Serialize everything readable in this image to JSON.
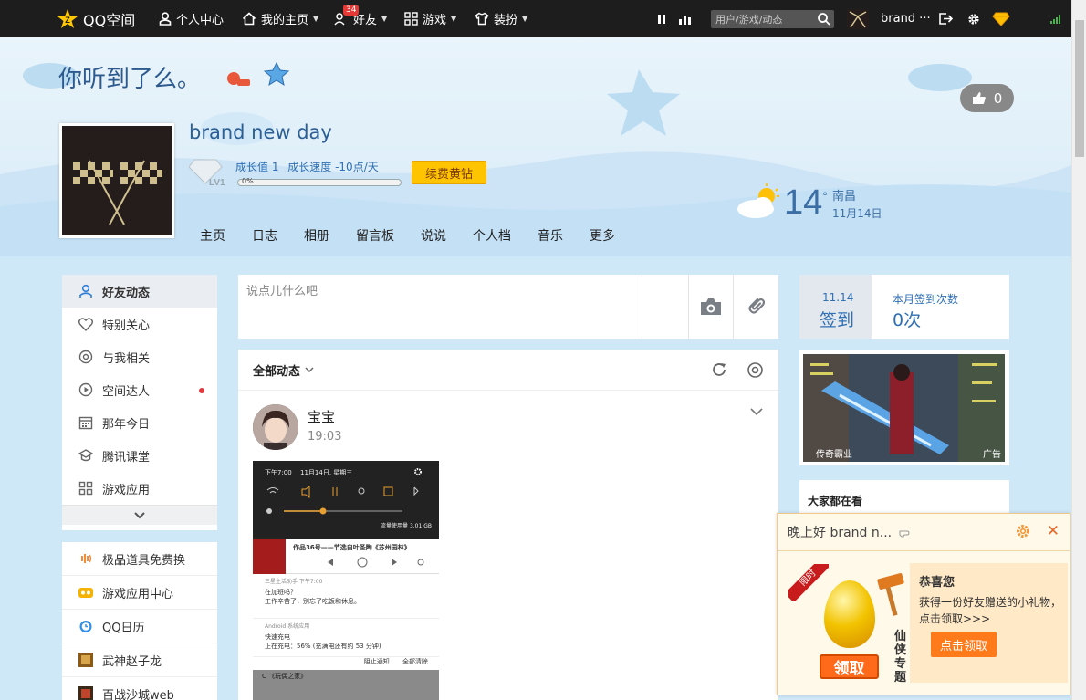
{
  "topbar": {
    "logo_text": "QQ空间",
    "personal_center": "个人中心",
    "my_homepage": "我的主页",
    "friends": "好友",
    "friends_badge": "34",
    "games": "游戏",
    "dress_up": "装扮",
    "search_placeholder": "用户/游戏/动态",
    "username": "brand ···"
  },
  "header": {
    "space_title": "你听到了么。",
    "nickname": "brand new day",
    "level_badge": "LV1",
    "growth_value": "成长值 1",
    "growth_speed": "成长速度 -10点/天",
    "progress_text": "0%",
    "progress": 0,
    "vip_button": "续费黄钻",
    "like_count": "0",
    "nav": [
      "主页",
      "日志",
      "相册",
      "留言板",
      "说说",
      "个人档",
      "音乐",
      "更多"
    ]
  },
  "weather": {
    "temperature": "14",
    "degree": "°",
    "city": "南昌",
    "date": "11月14日"
  },
  "sidebar": {
    "items": [
      {
        "label": "好友动态",
        "icon": "person-icon",
        "active": true
      },
      {
        "label": "特别关心",
        "icon": "heart-icon"
      },
      {
        "label": "与我相关",
        "icon": "at-icon"
      },
      {
        "label": "空间达人",
        "icon": "play-icon",
        "dot": true
      },
      {
        "label": "那年今日",
        "icon": "calendar-icon"
      },
      {
        "label": "腾讯课堂",
        "icon": "graduation-icon"
      },
      {
        "label": "游戏应用",
        "icon": "grid-icon"
      }
    ],
    "apps": [
      {
        "label": "极品道具免费换",
        "icon": "sound-icon"
      },
      {
        "label": "游戏应用中心",
        "icon": "game-center-icon"
      },
      {
        "label": "QQ日历",
        "icon": "clock-icon"
      },
      {
        "label": "武神赵子龙",
        "icon": "game-tile-icon"
      },
      {
        "label": "百战沙城web",
        "icon": "game-tile-icon"
      }
    ]
  },
  "composer": {
    "placeholder": "说点儿什么吧"
  },
  "feed": {
    "filter_label": "全部动态",
    "post": {
      "author": "宝宝",
      "time": "19:03",
      "image": {
        "status_time": "下午7:00",
        "status_date": "11月14日, 星期三",
        "data_usage": "流量使用量 3.01 GB",
        "music_title": "作品36号——节选自叶圣陶《苏州园林》",
        "notif_app": "三星生活助手  下午7:00",
        "notif_title": "在加班吗？",
        "notif_body": "工作辛苦了，别忘了吃饭和休息。",
        "system_app": "Android 系统应用",
        "charge_title": "快速充电",
        "charge_body": "正在充电：56% (充满电还有约 53 分钟)",
        "block_notif": "阻止通知",
        "clear_all": "全部清除",
        "bottom_text": "C 《玩偶之家》"
      }
    }
  },
  "checkin": {
    "date": "11.14",
    "button": "签到",
    "month_label": "本月签到次数",
    "month_count": "0次"
  },
  "ad": {
    "title": "传奇霸业",
    "tag": "广告"
  },
  "watching": {
    "title": "大家都在看"
  },
  "popup": {
    "greeting": "晚上好 brand n...",
    "ribbon": "限时",
    "claim_button": "领取",
    "game_name": "仙侠专题",
    "congrats": "恭喜您",
    "description": "获得一份好友赠送的小礼物，点击领取>>>",
    "cta": "点击领取"
  },
  "colors": {
    "topbar": "#1d1d1d",
    "vip": "#ffc400",
    "accent_blue": "#2f6fb4",
    "popup_orange": "#ff7a1a"
  }
}
